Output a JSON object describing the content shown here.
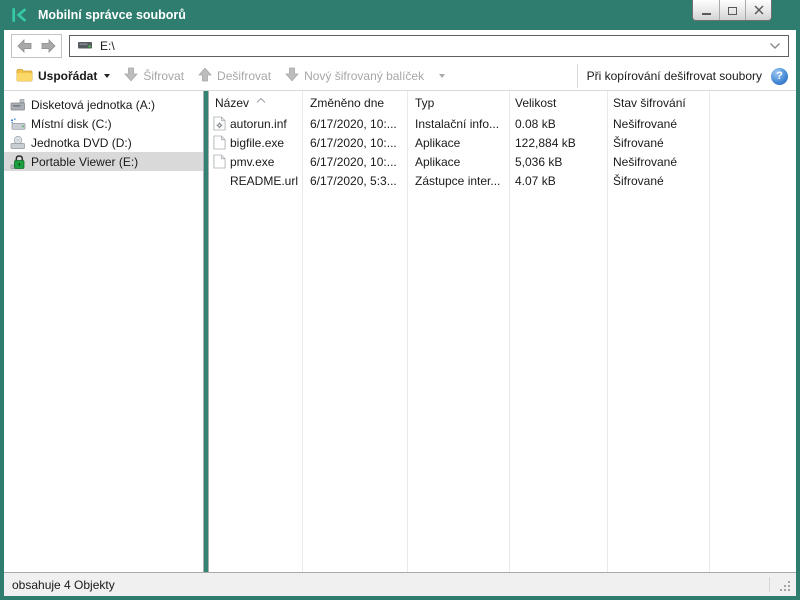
{
  "window": {
    "title": "Mobilní správce souborů"
  },
  "colors": {
    "titlebar_teal": "#2E7D6E",
    "logo_green": "#36C9A6",
    "selected_row_bg": "#D9D9D9",
    "disabled_text": "#A7A7A7",
    "help_blue": "#3D7ED6",
    "folder_yellow": "#F2C348",
    "lock_green": "#1CA03F"
  },
  "icons": {
    "help_glyph": "?",
    "kaspersky_logo": "k-mark",
    "back": "arrow-left",
    "forward": "arrow-right",
    "address_drive": "drive-with-led",
    "organize": "folder-yellow",
    "encrypt": "arrow-down",
    "decrypt": "arrow-up",
    "new_package": "arrow-down",
    "dropdown": "triangle-down",
    "sort": "chevron-up",
    "autorun_file": "page-with-gear",
    "plain_file": "blank-page",
    "resize_grip": "dot-triangle",
    "minimize": "dash",
    "maximize": "square",
    "close": "x"
  },
  "navbar": {
    "address": "E:\\"
  },
  "toolbar": {
    "organize_label": "Uspořádat",
    "encrypt_label": "Šifrovat",
    "decrypt_label": "Dešifrovat",
    "new_package_label": "Nový šifrovaný balíček",
    "decrypt_on_copy_label": "Při kopírování dešifrovat soubory"
  },
  "sidebar": {
    "items": [
      {
        "label": "Disketová jednotka (A:)",
        "icon": "floppy-drive-icon",
        "selected": false
      },
      {
        "label": "Místní disk (C:)",
        "icon": "hard-disk-icon",
        "selected": false
      },
      {
        "label": "Jednotka DVD (D:)",
        "icon": "dvd-drive-icon",
        "selected": false
      },
      {
        "label": "Portable Viewer (E:)",
        "icon": "locked-drive-icon",
        "selected": true
      }
    ]
  },
  "filelist": {
    "columns": [
      "Název",
      "Změněno dne",
      "Typ",
      "Velikost",
      "Stav šifrování"
    ],
    "sort": {
      "column": "Název",
      "direction": "ascending"
    },
    "rows": [
      {
        "name": "autorun.inf",
        "modified": "6/17/2020, 10:...",
        "type": "Instalační info...",
        "size": "0.08 kB",
        "status": "Nešifrované"
      },
      {
        "name": "bigfile.exe",
        "modified": "6/17/2020, 10:...",
        "type": "Aplikace",
        "size": "122,884 kB",
        "status": "Šifrované"
      },
      {
        "name": "pmv.exe",
        "modified": "6/17/2020, 10:...",
        "type": "Aplikace",
        "size": "5,036 kB",
        "status": "Nešifrované"
      },
      {
        "name": "README.url",
        "modified": "6/17/2020, 5:3...",
        "type": "Zástupce inter...",
        "size": "4.07 kB",
        "status": "Šifrované"
      }
    ]
  },
  "statusbar": {
    "text": "obsahuje 4 Objekty"
  }
}
